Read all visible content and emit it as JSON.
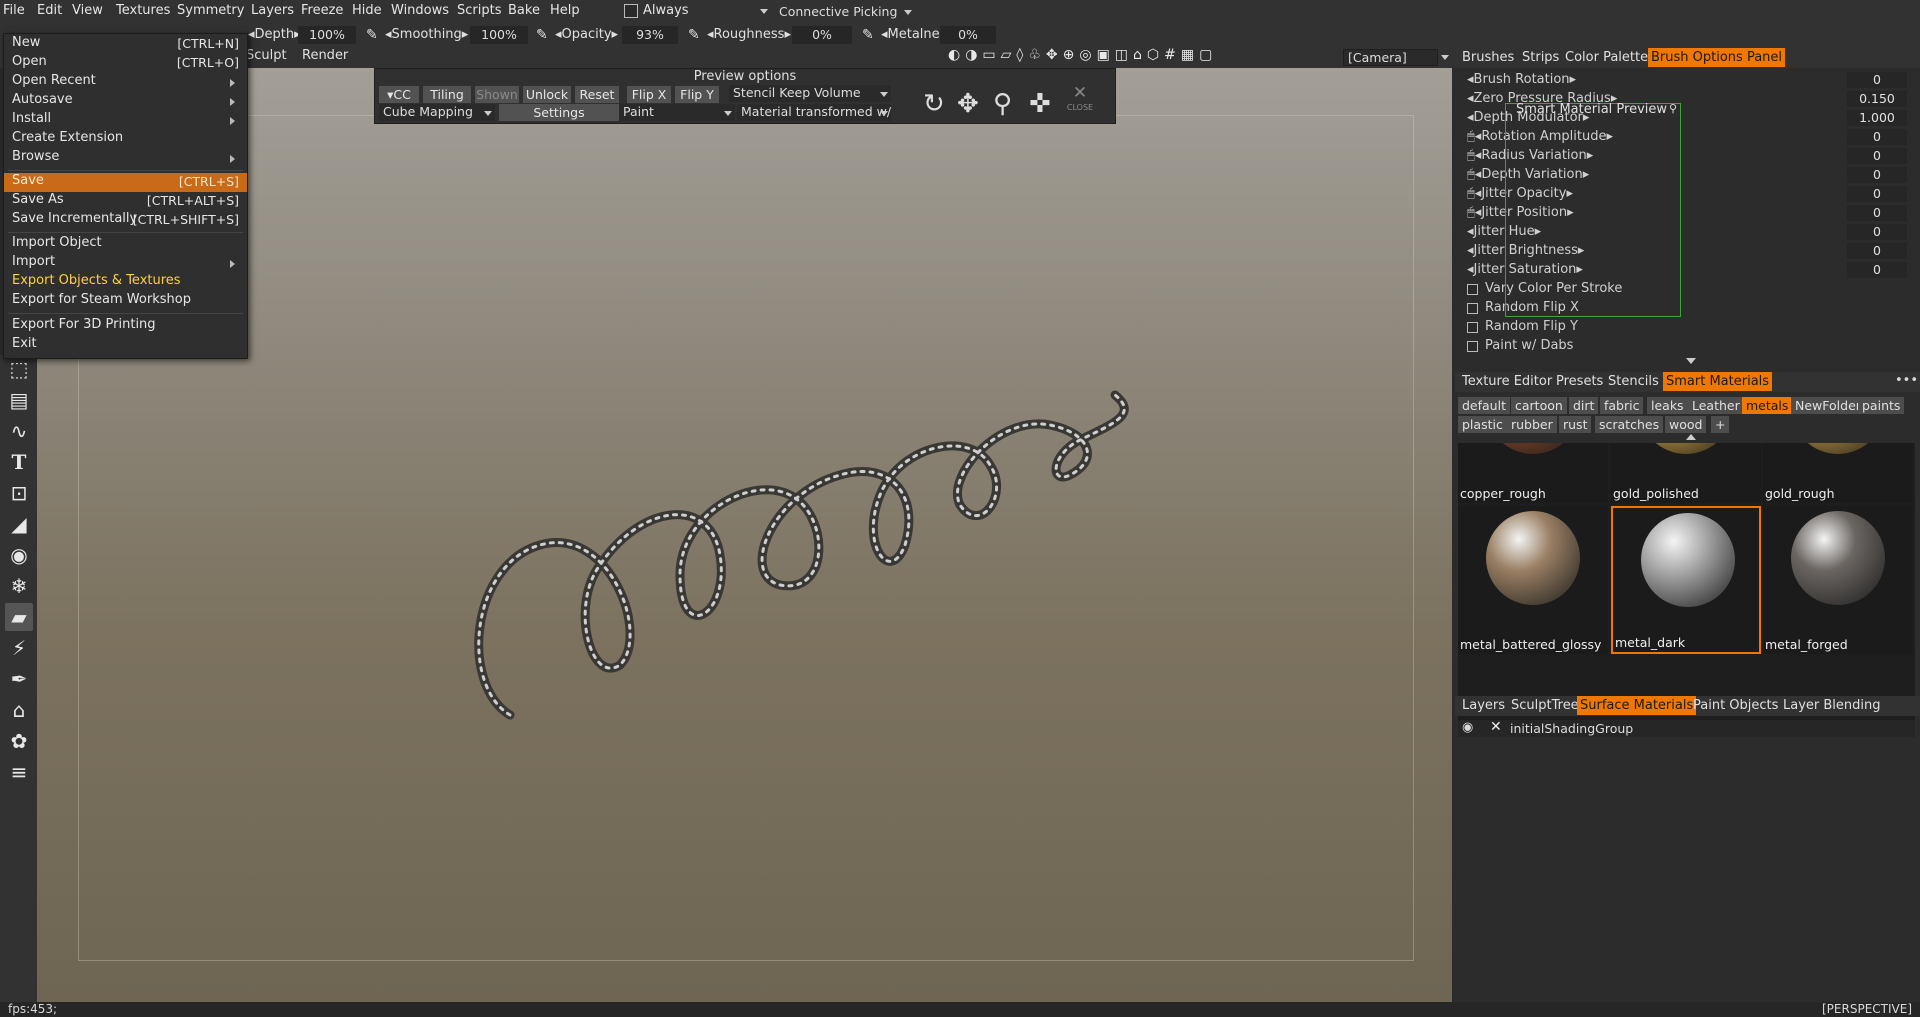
{
  "menubar": {
    "items": [
      "File",
      "Edit",
      "View",
      "Textures",
      "Symmetry",
      "Layers",
      "Freeze",
      "Hide",
      "Windows",
      "Scripts",
      "Bake",
      "Help"
    ],
    "always": "Always",
    "picking": "Connective Picking"
  },
  "brushbar": {
    "depth_label": "Depth",
    "depth": "100%",
    "smoothing_label": "Smoothing",
    "smoothing": "100%",
    "opacity_label": "Opacity",
    "opacity": "93%",
    "roughness_label": "Roughness",
    "roughness": "0%",
    "metalness_label": "Metalness",
    "metalness": "0%"
  },
  "roombar": {
    "sculpt": "Sculpt",
    "render": "Render",
    "camera": "[Camera]"
  },
  "filemenu": {
    "new": "New",
    "new_sc": "[CTRL+N]",
    "open": "Open",
    "open_sc": "[CTRL+O]",
    "open_recent": "Open Recent",
    "autosave": "Autosave",
    "install": "Install",
    "create_extension": "Create Extension",
    "browse": "Browse",
    "save": "Save",
    "save_sc": "[CTRL+S]",
    "save_as": "Save As",
    "save_as_sc": "[CTRL+ALT+S]",
    "save_inc": "Save Incrementally",
    "save_inc_sc": "[CTRL+SHIFT+S]",
    "import_object": "Import Object",
    "import": "Import",
    "export_objects": "Export Objects & Textures",
    "export_steam": "Export for Steam Workshop",
    "export_3d": "Export For 3D Printing",
    "exit": "Exit"
  },
  "preview": {
    "title": "Preview options",
    "cc": "CC",
    "tiling": "Tiling",
    "shown": "Shown",
    "unlock": "Unlock",
    "reset": "Reset",
    "flipx": "Flip X",
    "flipy": "Flip Y",
    "stencil": "Stencil Keep Volume",
    "mapping": "Cube Mapping",
    "settings": "Settings",
    "paint": "Paint",
    "material_mode": "Material transformed w/",
    "close": "CLOSE"
  },
  "panel_tabs": [
    "Brushes",
    "Strips",
    "Color Palette",
    "Brush Options Panel"
  ],
  "brush_options": [
    {
      "label": "Brush Rotation",
      "value": "0"
    },
    {
      "label": "Zero Pressure Radius",
      "value": "0.150"
    },
    {
      "label": "Depth Modulator",
      "value": "1.000"
    },
    {
      "label": "Rotation Amplitude",
      "value": "0"
    },
    {
      "label": "Radius Variation",
      "value": "0"
    },
    {
      "label": "Depth Variation",
      "value": "0"
    },
    {
      "label": "Jitter Opacity",
      "value": "0"
    },
    {
      "label": "Jitter Position",
      "value": "0"
    },
    {
      "label": "Jitter Hue",
      "value": "0"
    },
    {
      "label": "Jitter Brightness",
      "value": "0"
    },
    {
      "label": "Jitter Saturation",
      "value": "0"
    }
  ],
  "brush_checks": [
    "Vary Color Per Stroke",
    "Random Flip X",
    "Random Flip Y",
    "Paint w/ Dabs"
  ],
  "smart_preview": "Smart Material Preview",
  "mat_tabs": [
    "Texture Editor",
    "Presets",
    "Stencils",
    "Smart Materials"
  ],
  "mat_categories": [
    "default",
    "cartoon",
    "dirt",
    "fabric",
    "leaks",
    "Leather",
    "metals",
    "NewFolder",
    "paints",
    "plastic",
    "rubber",
    "rust",
    "scratches",
    "wood",
    "+"
  ],
  "materials": [
    {
      "name": "copper_rough",
      "color": "#8a4a2c"
    },
    {
      "name": "gold_polished",
      "color": "#c9a040"
    },
    {
      "name": "gold_rough",
      "color": "#c49a44"
    },
    {
      "name": "metal_battered_glossy",
      "color": "#9a8064"
    },
    {
      "name": "metal_dark",
      "color": "#a8a8a8"
    },
    {
      "name": "metal_forged",
      "color": "#6b6662"
    }
  ],
  "layer_tabs": [
    "Layers",
    "SculptTree",
    "Surface Materials",
    "Paint Objects",
    "Layer Blending"
  ],
  "shading_group": "initialShadingGroup",
  "status": {
    "fps": "fps:453;",
    "view": "[PERSPECTIVE]"
  },
  "colors": {
    "accent": "#f07800",
    "highlight_text": "#ffd040",
    "preview_border": "#3aa63a"
  }
}
